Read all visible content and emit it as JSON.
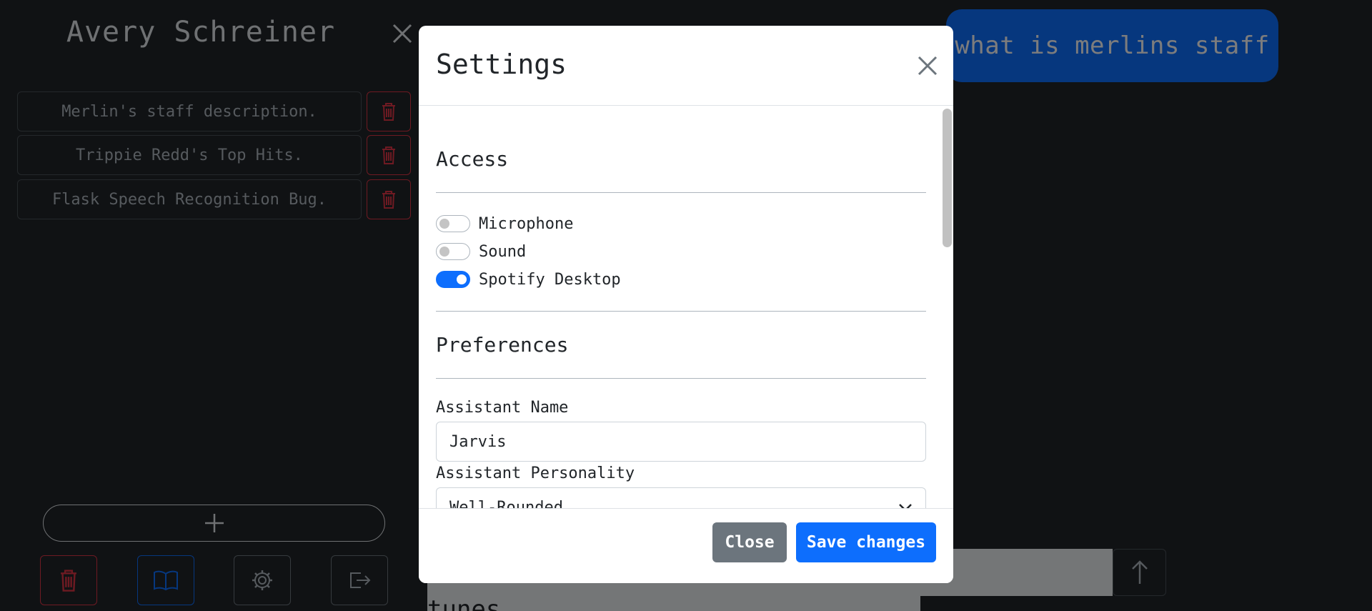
{
  "sidebar": {
    "title": "Avery Schreiner",
    "chats": [
      {
        "label": "Merlin's staff description."
      },
      {
        "label": "Trippie Redd's Top Hits."
      },
      {
        "label": "Flask Speech Recognition Bug."
      }
    ],
    "footer_icons": [
      "trash-icon",
      "book-icon",
      "gear-icon",
      "logout-icon"
    ]
  },
  "chat": {
    "user_message": "what is merlins staff",
    "lower_text": "tunes"
  },
  "colors": {
    "primary": "#0d6efd",
    "danger": "#dc3545",
    "secondary": "#6c757d",
    "background": "#212529"
  },
  "modal": {
    "title": "Settings",
    "access": {
      "title": "Access",
      "toggles": [
        {
          "label": "Microphone",
          "on": false
        },
        {
          "label": "Sound",
          "on": false
        },
        {
          "label": "Spotify Desktop",
          "on": true
        }
      ]
    },
    "preferences": {
      "title": "Preferences",
      "assistant_name_label": "Assistant Name",
      "assistant_name_value": "Jarvis",
      "assistant_personality_label": "Assistant Personality",
      "assistant_personality_value": "Well-Rounded"
    },
    "buttons": {
      "close": "Close",
      "save": "Save changes"
    }
  }
}
